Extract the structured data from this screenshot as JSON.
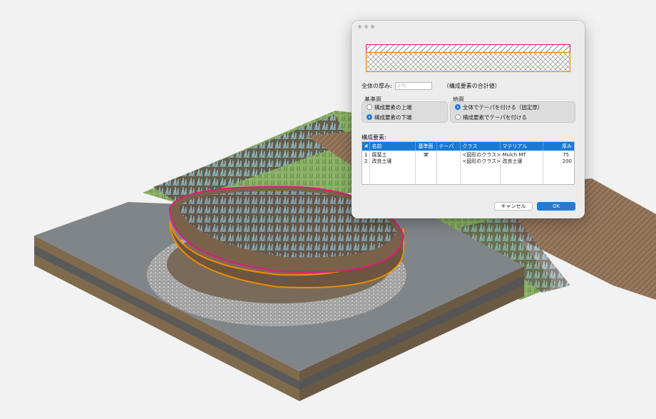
{
  "dialog": {
    "thickness_label": "全体の厚み:",
    "thickness_value": "275",
    "thickness_note": "（構成要素の合計値）",
    "datum_group": {
      "title": "基準面",
      "options": [
        {
          "label": "構成要素の上端",
          "selected": false
        },
        {
          "label": "構成要素の下端",
          "selected": true
        }
      ]
    },
    "ground_group": {
      "title": "地面",
      "options": [
        {
          "label": "全体でテーパを付ける（固定厚）",
          "selected": true
        },
        {
          "label": "構成要素でテーパを付ける",
          "selected": false
        }
      ]
    },
    "components_label": "構成要素:",
    "table": {
      "headers": [
        "#",
        "名前",
        "基準面",
        "テーパ",
        "クラス",
        "マテリアル",
        "厚み"
      ],
      "rows": [
        {
          "num": "1",
          "name": "腐葉土",
          "datum_icon": "datum-plane-icon",
          "taper": "",
          "class": "<図形のクラス>",
          "material": "Mulch MT",
          "thickness": "75"
        },
        {
          "num": "2",
          "name": "改良土壌",
          "datum_icon": "",
          "taper": "",
          "class": "<図形のクラス>",
          "material": "改良土壌",
          "thickness": "200"
        }
      ]
    },
    "cancel_label": "キャンセル",
    "ok_label": "OK"
  },
  "colors": {
    "accent": "#1f7ad8",
    "layer_top_outline": "#e0197d",
    "layer_bottom_outline": "#f08c00",
    "paving": "#7b7f82",
    "mulch": "#6f5a45",
    "grass": "#7fa35a",
    "cobble": "#a9a9a9"
  }
}
